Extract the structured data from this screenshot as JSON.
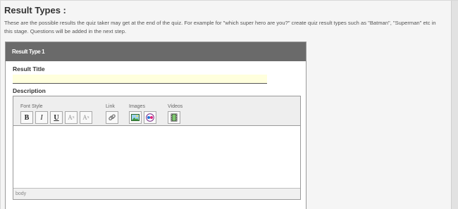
{
  "section": {
    "title": "Result Types :",
    "intro_line1": "These are the possible results the quiz taker may get at the end of the quiz. For example for \"which super hero are you?\" create quiz result types such as \"Batman\", \"Superman\" etc in",
    "intro_line2": "this stage. Questions will be added in the next step."
  },
  "result_type": {
    "header": "Result Type 1",
    "title_label": "Result Title",
    "title_value": "",
    "description_label": "Description"
  },
  "editor": {
    "font_style_label": "Font Style",
    "link_label": "Link",
    "images_label": "Images",
    "videos_label": "Videos",
    "bold_glyph": "B",
    "italic_glyph": "I",
    "underline_glyph": "U",
    "status_path": "body"
  },
  "colors": {
    "header_bg": "#6a6a6a",
    "title_input_bg": "#ffffdd"
  }
}
